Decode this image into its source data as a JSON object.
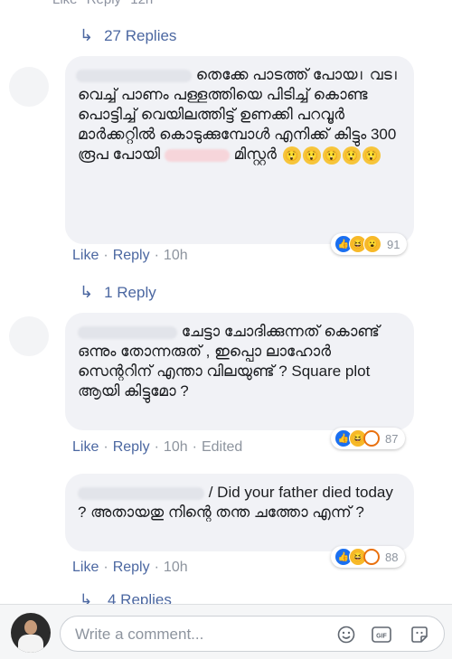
{
  "top_fragment": {
    "like": "Like",
    "reply": "Reply",
    "time": "12h"
  },
  "thread1": {
    "replies_label": "27 Replies"
  },
  "comment1": {
    "text": "തെക്കേ പാടത്ത് പോയ। വട। വെച്ച് പാണം പള്ളത്തിയെ പിടിച്ച് കൊണ്ട പൊട്ടിച്ച് വെയിലത്തിട്ട് ഉണക്കി പറവൂർ മാർക്കറ്റിൽ കൊടുക്കുമ്പോൾ എനിക്ക് കിട്ടും 300 രൂപ പോയി",
    "text_tail": "മിസ്റ്റർ",
    "reactions_count": "91",
    "like": "Like",
    "reply": "Reply",
    "time": "10h"
  },
  "thread2": {
    "replies_label": "1 Reply"
  },
  "comment2": {
    "text": "ചേട്ടാ ചോദിക്കുന്നത് കൊണ്ട് ഒന്നും തോന്നരുത് , ഇപ്പൊ ലാഹോർ സെന്ററിന് എന്താ വിലയുണ്ട് ? Square plot ആയി കിട്ടുമോ ?",
    "reactions_count": "87",
    "like": "Like",
    "reply": "Reply",
    "time": "10h",
    "edited": "Edited"
  },
  "comment3": {
    "text": "/ Did your father died today ? അതായതു നിന്റെ തന്ത ചത്തോ എന്ന് ?",
    "reactions_count": "88",
    "like": "Like",
    "reply": "Reply",
    "time": "10h"
  },
  "thread3": {
    "replies_label": "4 Replies"
  },
  "composer": {
    "placeholder": "Write a comment..."
  },
  "icons": [
    "reply-arrow-icon",
    "like-reaction-icon",
    "haha-reaction-icon",
    "wow-reaction-icon",
    "angry-reaction-icon",
    "emoji-icon",
    "gif-icon",
    "sticker-icon"
  ],
  "colors": {
    "link": "#4b67a1",
    "bubble": "#f1f2f6",
    "like_blue": "#1a6ff0",
    "muted": "#8d949e"
  }
}
